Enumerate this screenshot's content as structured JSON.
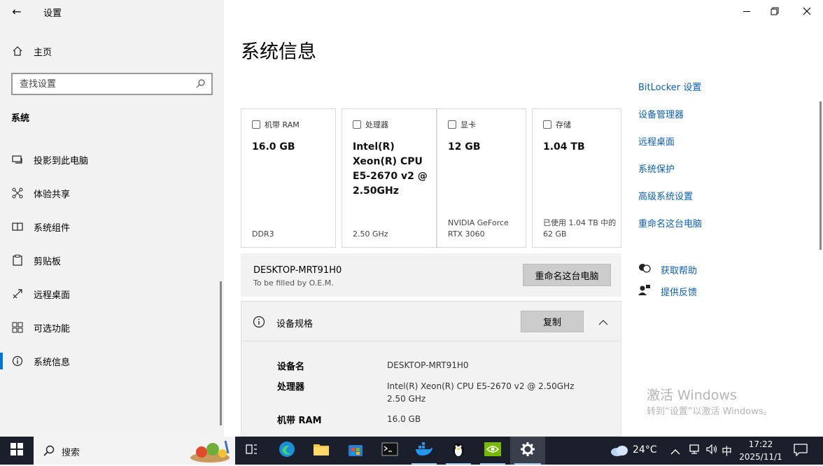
{
  "window": {
    "title": "设置",
    "colors": {
      "sidebar_bg": "#f2f2f2",
      "accent": "#0078d4",
      "link": "#0a5fb4",
      "taskbar": "#1b1f2b"
    }
  },
  "sidebar": {
    "home": "主页",
    "search_placeholder": "查找设置",
    "section": "系统",
    "items": [
      {
        "label": "投影到此电脑",
        "icon": "projector-icon"
      },
      {
        "label": "体验共享",
        "icon": "share-icon"
      },
      {
        "label": "系统组件",
        "icon": "components-icon"
      },
      {
        "label": "剪贴板",
        "icon": "clipboard-icon"
      },
      {
        "label": "远程桌面",
        "icon": "remote-desktop-icon"
      },
      {
        "label": "可选功能",
        "icon": "optional-features-icon"
      },
      {
        "label": "系统信息",
        "icon": "info-icon",
        "selected": true
      }
    ]
  },
  "main": {
    "title": "系统信息",
    "cards": [
      {
        "label": "机带 RAM",
        "value": "16.0 GB",
        "sub": "DDR3",
        "icon": "ram-icon"
      },
      {
        "label": "处理器",
        "value": "Intel(R) Xeon(R) CPU E5-2670 v2 @ 2.50GHz",
        "sub": "2.50 GHz",
        "icon": "cpu-icon"
      },
      {
        "label": "显卡",
        "value": "12 GB",
        "sub": "NVIDIA GeForce RTX 3060",
        "icon": "gpu-icon"
      },
      {
        "label": "存储",
        "value": "1.04 TB",
        "sub": "已使用 1.04 TB 中的 62 GB",
        "icon": "storage-icon"
      }
    ],
    "pc": {
      "name": "DESKTOP-MRT91H0",
      "oem": "To be filled by O.E.M.",
      "rename_button": "重命名这台电脑"
    },
    "specs": {
      "header": "设备规格",
      "copy_button": "复制",
      "rows": [
        {
          "label": "设备名",
          "value": "DESKTOP-MRT91H0"
        },
        {
          "label": "处理器",
          "value": "Intel(R) Xeon(R) CPU E5-2670 v2 @ 2.50GHz",
          "value2": "2.50 GHz"
        },
        {
          "label": "机带 RAM",
          "value": "16.0 GB"
        }
      ]
    }
  },
  "links": [
    "BitLocker 设置",
    "设备管理器",
    "远程桌面",
    "系统保护",
    "高级系统设置",
    "重命名这台电脑"
  ],
  "help": {
    "get_help": "获取帮助",
    "feedback": "提供反馈"
  },
  "watermark": {
    "title": "激活 Windows",
    "subtitle": "转到“设置”以激活 Windows。"
  },
  "taskbar": {
    "search_label": "搜索",
    "weather": "24°C",
    "ime": "中",
    "time": "17:22",
    "date": "2025/11/1"
  }
}
